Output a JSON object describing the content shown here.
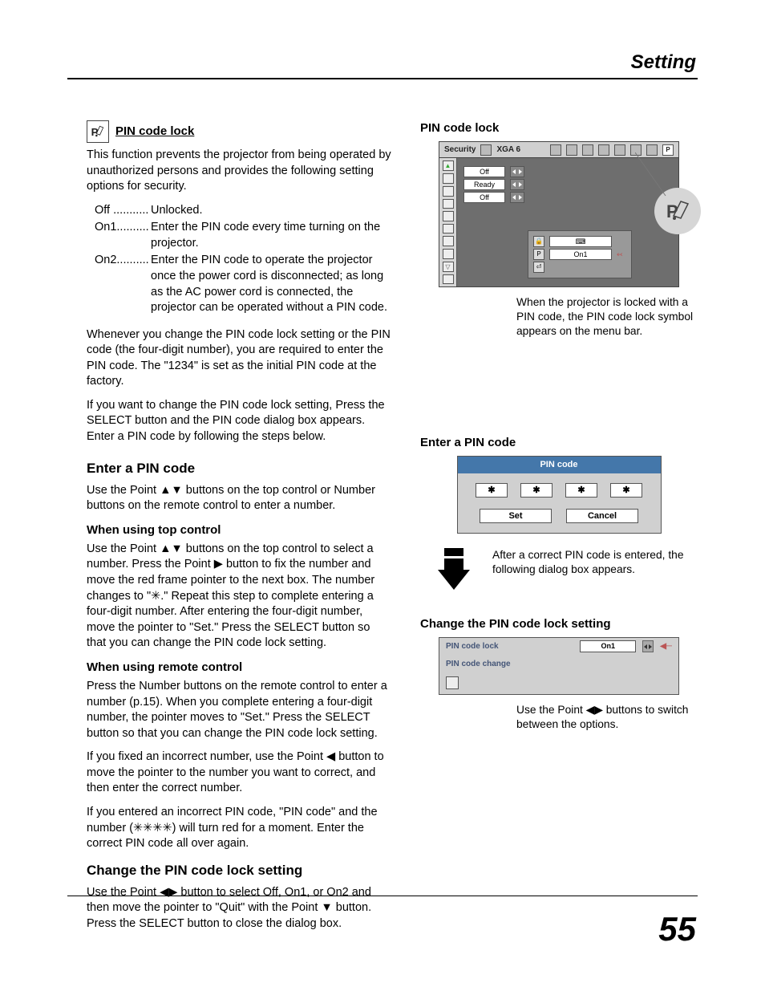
{
  "header": {
    "title": "Setting"
  },
  "page_number": "55",
  "left": {
    "pin_lock_title": "PIN code lock",
    "intro": "This function prevents the projector from being operated by unauthorized persons and provides the following setting options for security.",
    "options": [
      {
        "key": "Off ...........",
        "desc": "Unlocked."
      },
      {
        "key": "On1..........",
        "desc": "Enter the PIN code every time turning on the projector."
      },
      {
        "key": "On2..........",
        "desc": "Enter the PIN code to operate the projector once the power cord is disconnected; as long as the AC power cord is connected, the projector can be operated without a PIN code."
      }
    ],
    "para1": "Whenever you change the PIN code lock setting or the PIN code (the four-digit number), you are required to enter the PIN code. The \"1234\" is set as the initial PIN code at the factory.",
    "para2": "If you want to change the PIN code lock setting, Press the SELECT button and the PIN code dialog box appears. Enter a PIN code by following the steps below.",
    "enter_title": "Enter a PIN code",
    "enter_intro": "Use the Point ▲▼ buttons on the top control or Number buttons on the remote control to enter a number.",
    "top_ctrl_title": "When using top control",
    "top_ctrl_body": "Use the Point ▲▼ buttons on the top control to select a number. Press the Point ▶ button to fix the number and move the red frame pointer to the next box. The number changes to \"✳.\" Repeat this step to complete entering a four-digit number. After entering the four-digit number, move the pointer to \"Set.\" Press the SELECT button so that you can change the PIN code lock setting.",
    "remote_title": "When using remote control",
    "remote_body": "Press the Number buttons on the remote control to enter a number (p.15). When you complete entering a four-digit number, the pointer moves to \"Set.\" Press the SELECT button so that you can change the PIN code lock setting.",
    "fix_body": "If you fixed an incorrect number, use the Point ◀ button to move the pointer to the number you want to correct, and then enter the correct number.",
    "wrong_body": "If you entered an incorrect PIN code, \"PIN code\" and the number (✳✳✳✳) will turn red for a moment. Enter the correct PIN code all over again.",
    "change_title": "Change the PIN code lock setting",
    "change_body": "Use the Point ◀▶ button to select Off, On1, or On2 and then move the pointer to \"Quit\" with the Point ▼ button. Press the SELECT button to close the dialog box."
  },
  "right": {
    "pin_lock_title": "PIN code lock",
    "osd": {
      "title": "Security",
      "xga": "XGA 6",
      "opts": [
        "Off",
        "Ready",
        "Off"
      ],
      "sub_label": "On1"
    },
    "locked_caption": "When the projector is locked with a PIN code, the PIN code lock symbol appears on the menu bar.",
    "enter_title": "Enter a PIN code",
    "pin_dialog": {
      "title": "PIN code",
      "digits": [
        "✱",
        "✱",
        "✱",
        "✱"
      ],
      "set": "Set",
      "cancel": "Cancel"
    },
    "after_caption": "After a correct PIN code is entered, the following dialog box appears.",
    "change_title": "Change the PIN code lock setting",
    "chg_dialog": {
      "row1_label": "PIN code lock",
      "row1_value": "On1",
      "row2_label": "PIN code change"
    },
    "switch_caption": "Use the Point ◀▶ buttons to switch between the options."
  }
}
